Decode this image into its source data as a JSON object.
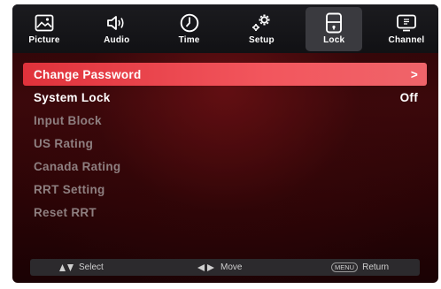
{
  "tabs": [
    {
      "label": "Picture",
      "icon": "picture-icon",
      "active": false
    },
    {
      "label": "Audio",
      "icon": "speaker-icon",
      "active": false
    },
    {
      "label": "Time",
      "icon": "clock-icon",
      "active": false
    },
    {
      "label": "Setup",
      "icon": "gears-icon",
      "active": false
    },
    {
      "label": "Lock",
      "icon": "lock-icon",
      "active": true
    },
    {
      "label": "Channel",
      "icon": "tv-icon",
      "active": false
    }
  ],
  "menu": {
    "items": [
      {
        "label": "Change Password",
        "value": ">",
        "state": "selected"
      },
      {
        "label": "System Lock",
        "value": "Off",
        "state": "enabled"
      },
      {
        "label": "Input Block",
        "value": "",
        "state": "disabled"
      },
      {
        "label": "US Rating",
        "value": "",
        "state": "disabled"
      },
      {
        "label": "Canada Rating",
        "value": "",
        "state": "disabled"
      },
      {
        "label": "RRT Setting",
        "value": "",
        "state": "disabled"
      },
      {
        "label": "Reset RRT",
        "value": "",
        "state": "disabled"
      }
    ]
  },
  "footer": {
    "select": "Select",
    "move": "Move",
    "menu_key": "MENU",
    "return": "Return"
  },
  "colors": {
    "accent": "#e8444b",
    "background": "#3b080b",
    "topbar": "#16161a"
  }
}
